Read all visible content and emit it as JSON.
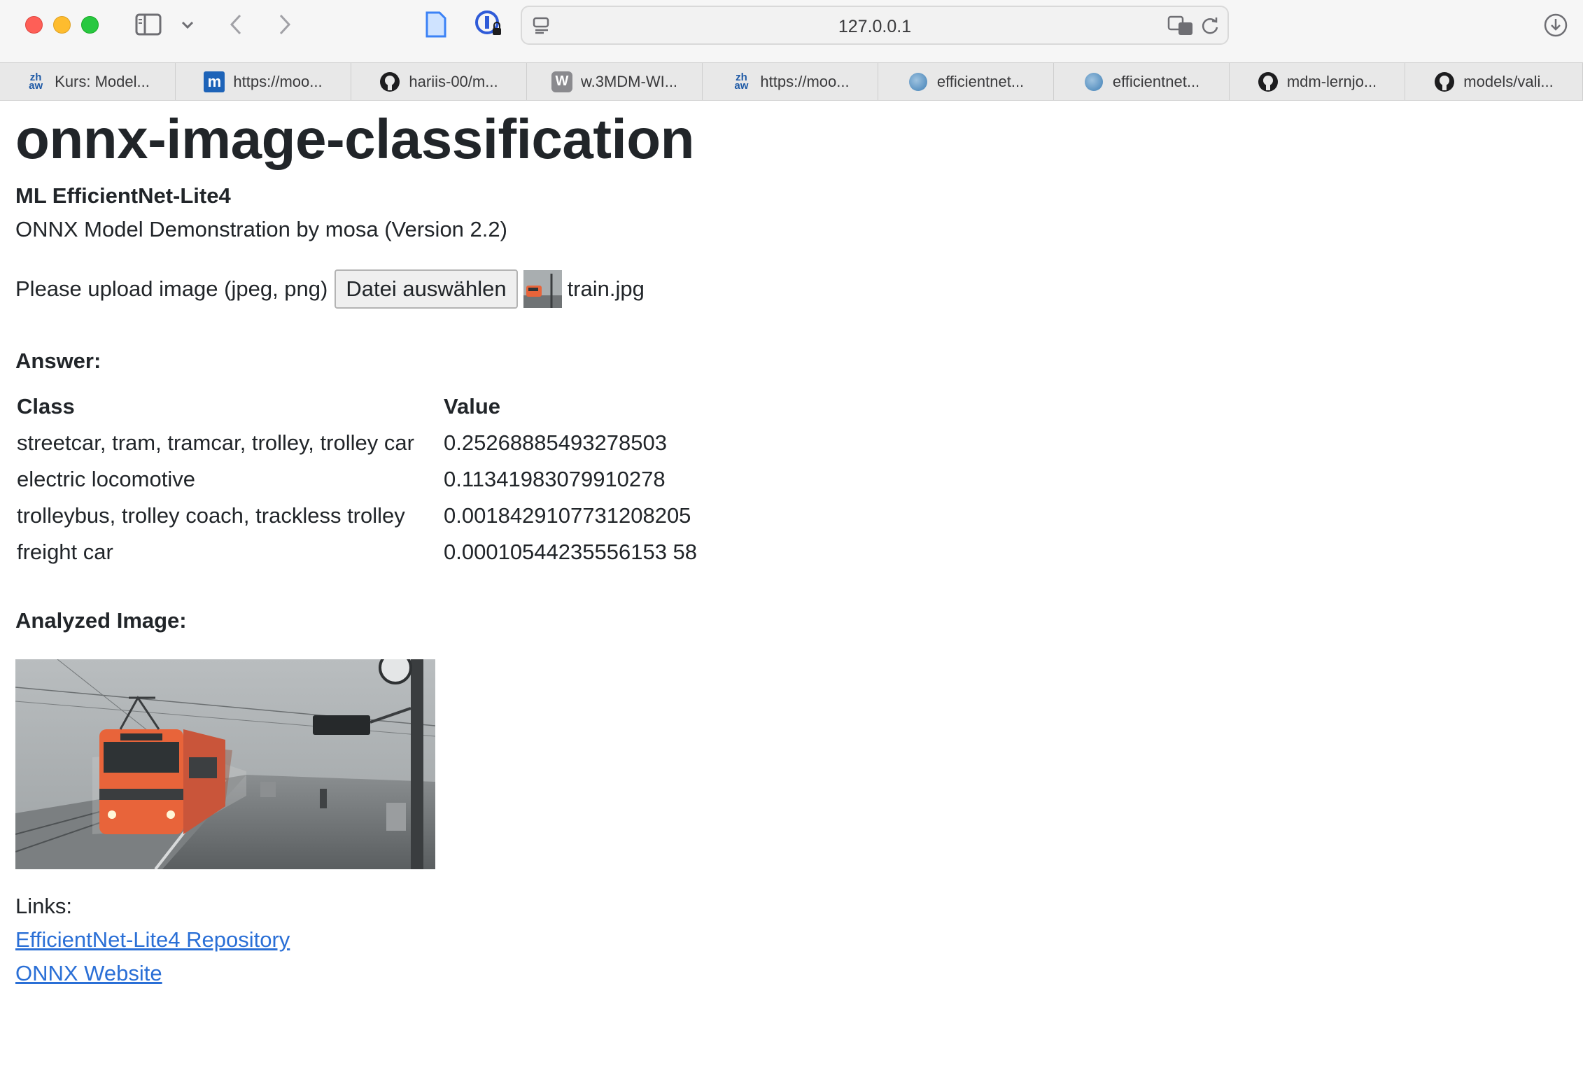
{
  "browser": {
    "address": "127.0.0.1",
    "tabs": [
      {
        "label": "Kurs: Model...",
        "icon": "zhaw-icon"
      },
      {
        "label": "https://moo...",
        "icon": "moodle-icon"
      },
      {
        "label": "hariis-00/m...",
        "icon": "github-icon"
      },
      {
        "label": "w.3MDM-WI...",
        "icon": "w-icon"
      },
      {
        "label": "https://moo...",
        "icon": "zhaw-icon"
      },
      {
        "label": "efficientnet...",
        "icon": "globe-icon"
      },
      {
        "label": "efficientnet...",
        "icon": "globe-icon"
      },
      {
        "label": "mdm-lernjo...",
        "icon": "github-icon"
      },
      {
        "label": "models/vali...",
        "icon": "github-icon"
      }
    ]
  },
  "page": {
    "title": "onnx-image-classification",
    "subtitle": "ML EfficientNet-Lite4",
    "description": "ONNX Model Demonstration by mosa (Version 2.2)",
    "upload": {
      "label": "Please upload image (jpeg, png)",
      "button": "Datei auswählen",
      "file_name": "train.jpg"
    },
    "answer_heading": "Answer:",
    "table": {
      "headers": [
        "Class",
        "Value"
      ],
      "rows": [
        {
          "class": "streetcar, tram, tramcar, trolley, trolley car",
          "value": "0.25268885493278503"
        },
        {
          "class": "electric locomotive",
          "value": "0.11341983079910278"
        },
        {
          "class": "trolleybus, trolley coach, trackless trolley",
          "value": "0.0018429107731208205"
        },
        {
          "class": "freight car",
          "value": "0.00010544235556153 58"
        }
      ]
    },
    "analyzed_heading": "Analyzed Image:",
    "links_label": "Links:",
    "links": [
      "EfficientNet-Lite4 Repository",
      "ONNX Website"
    ]
  },
  "colors": {
    "link": "#2a6fd6",
    "train": "#e8643a"
  }
}
